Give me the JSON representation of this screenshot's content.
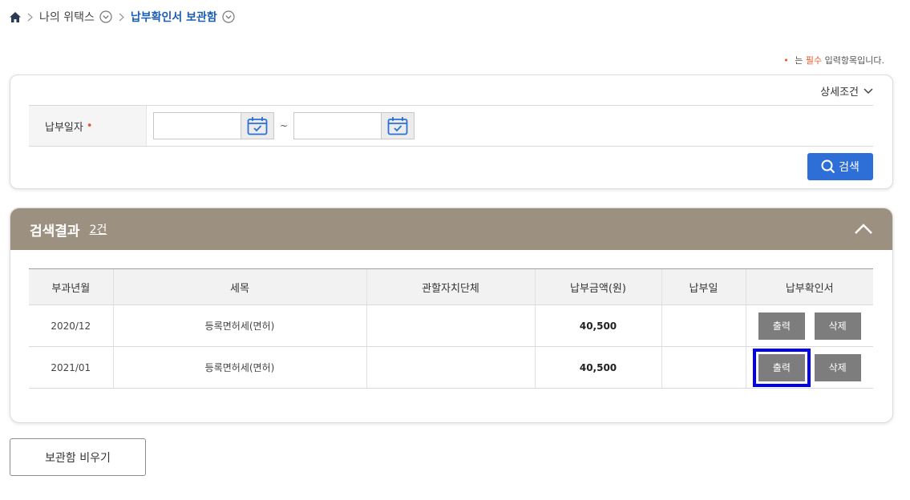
{
  "breadcrumb": {
    "home_icon": "home-icon",
    "items": [
      "나의 위택스",
      "납부확인서 보관함"
    ]
  },
  "required_note": {
    "prefix": "는",
    "strong": "필수",
    "suffix": "입력항목입니다."
  },
  "search": {
    "detail_toggle": "상세조건",
    "date_label": "납부일자",
    "date_from": "",
    "date_to": "",
    "tilde": "~",
    "search_button": "검색"
  },
  "results": {
    "title": "검색결과",
    "count": "2건",
    "columns": [
      "부과년월",
      "세목",
      "관할자치단체",
      "납부금액(원)",
      "납부일",
      "납부확인서"
    ],
    "rows": [
      {
        "period": "2020/12",
        "tax_item": "등록면허세(면허)",
        "authority": "",
        "amount": "40,500",
        "paid_date": "",
        "print": "출력",
        "delete": "삭제"
      },
      {
        "period": "2021/01",
        "tax_item": "등록면허세(면허)",
        "authority": "",
        "amount": "40,500",
        "paid_date": "",
        "print": "출력",
        "delete": "삭제"
      }
    ]
  },
  "empty_button": "보관함 비우기",
  "colors": {
    "accent_blue": "#2d6fd6",
    "results_header": "#9c9180",
    "required": "#e8572a",
    "highlight": "#0000ee"
  }
}
